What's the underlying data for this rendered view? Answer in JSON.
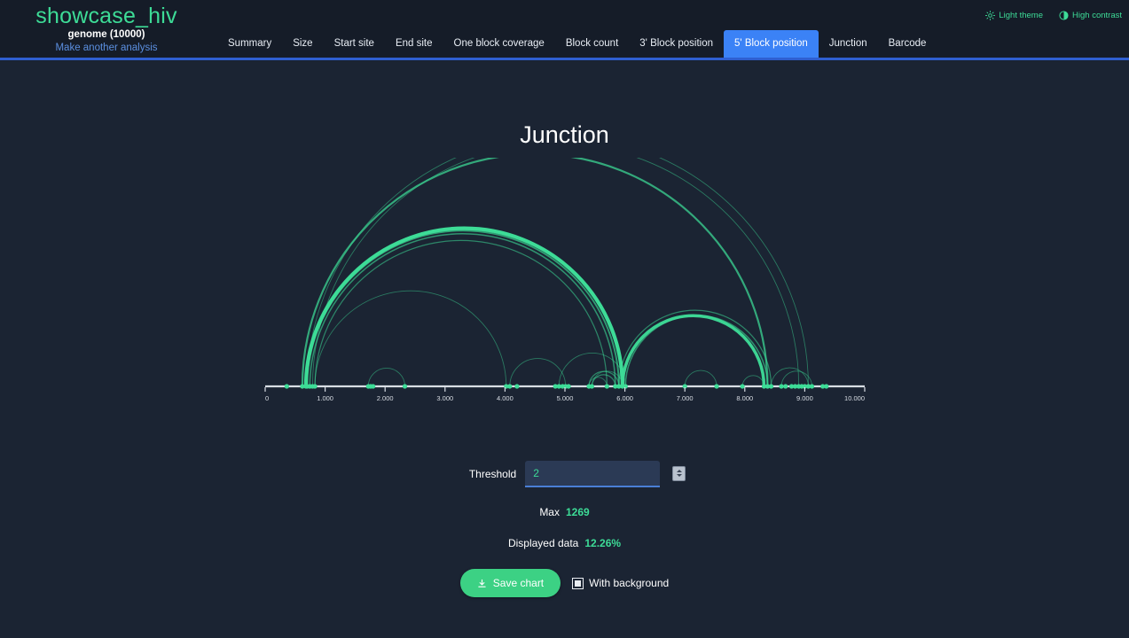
{
  "header": {
    "brand_title": "showcase_hiv",
    "brand_subtitle": "genome (10000)",
    "brand_link": "Make another analysis",
    "nav_items": [
      {
        "label": "Summary",
        "active": false
      },
      {
        "label": "Size",
        "active": false
      },
      {
        "label": "Start site",
        "active": false
      },
      {
        "label": "End site",
        "active": false
      },
      {
        "label": "One block coverage",
        "active": false
      },
      {
        "label": "Block count",
        "active": false
      },
      {
        "label": "3' Block position",
        "active": false
      },
      {
        "label": "5' Block position",
        "active": true
      },
      {
        "label": "Junction",
        "active": false
      },
      {
        "label": "Barcode",
        "active": false
      }
    ],
    "light_theme_label": "Light theme",
    "high_contrast_label": "High contrast"
  },
  "main": {
    "title": "Junction"
  },
  "controls": {
    "threshold_label": "Threshold",
    "threshold_value": "2",
    "threshold_placeholder": "",
    "max_label": "Max",
    "max_value": "1269",
    "displayed_label": "Displayed data",
    "displayed_value": "12.26%",
    "save_label": "Save chart",
    "with_background_label": "With background"
  },
  "colors": {
    "accent_green": "#3ddc97",
    "accent_blue": "#3b82f6",
    "background": "#1b2433",
    "header_background": "#151c28",
    "arc_stroke": "#3ddc97"
  },
  "chart_data": {
    "type": "arc",
    "title": "Junction",
    "xlabel": "",
    "ylabel": "",
    "xlim": [
      0,
      10000
    ],
    "grid": false,
    "legend": "none",
    "tick_labels": [
      "0",
      "1.000",
      "2.000",
      "3.000",
      "4.000",
      "5.000",
      "6.000",
      "7.000",
      "8.000",
      "9.000",
      "10.000"
    ],
    "tick_values": [
      0,
      1000,
      2000,
      3000,
      4000,
      5000,
      6000,
      7000,
      8000,
      9000,
      10000
    ],
    "max_count": 1269,
    "displayed_fraction": "12.26%",
    "threshold": 2,
    "nodes": [
      360,
      620,
      680,
      700,
      745,
      790,
      830,
      1720,
      1760,
      1800,
      2330,
      4020,
      4080,
      4200,
      4840,
      4900,
      4960,
      5010,
      5060,
      5400,
      5450,
      5700,
      5840,
      5900,
      5960,
      6010,
      7000,
      7530,
      7960,
      8320,
      8380,
      8440,
      8610,
      8680,
      8780,
      8840,
      8900,
      8950,
      9000,
      9060,
      9120,
      9300,
      9360
    ],
    "arcs": [
      {
        "start": 700,
        "end": 9060,
        "weight": 1
      },
      {
        "start": 790,
        "end": 8900,
        "weight": 1
      },
      {
        "start": 620,
        "end": 8380,
        "weight": 5
      },
      {
        "start": 680,
        "end": 5960,
        "weight": 12
      },
      {
        "start": 700,
        "end": 5900,
        "weight": 4
      },
      {
        "start": 745,
        "end": 5840,
        "weight": 3
      },
      {
        "start": 830,
        "end": 5700,
        "weight": 2
      },
      {
        "start": 830,
        "end": 4020,
        "weight": 1
      },
      {
        "start": 1720,
        "end": 2330,
        "weight": 1
      },
      {
        "start": 4080,
        "end": 5010,
        "weight": 1
      },
      {
        "start": 4900,
        "end": 6010,
        "weight": 1
      },
      {
        "start": 5400,
        "end": 5900,
        "weight": 2
      },
      {
        "start": 5450,
        "end": 5840,
        "weight": 2
      },
      {
        "start": 5400,
        "end": 5700,
        "weight": 1
      },
      {
        "start": 5450,
        "end": 5960,
        "weight": 1
      },
      {
        "start": 5960,
        "end": 8320,
        "weight": 9
      },
      {
        "start": 6010,
        "end": 8380,
        "weight": 3
      },
      {
        "start": 5900,
        "end": 8440,
        "weight": 2
      },
      {
        "start": 7000,
        "end": 7530,
        "weight": 1
      },
      {
        "start": 7960,
        "end": 8320,
        "weight": 1
      },
      {
        "start": 8440,
        "end": 9060,
        "weight": 1
      },
      {
        "start": 8610,
        "end": 9120,
        "weight": 1
      }
    ]
  }
}
